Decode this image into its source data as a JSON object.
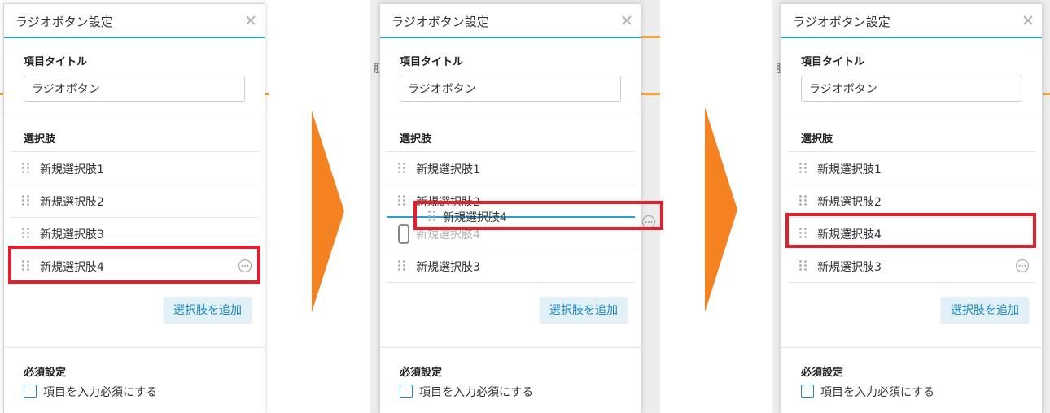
{
  "colors": {
    "accent": "#2a9fd6",
    "highlight": "#e0202c",
    "arrow": "#f58220",
    "button_bg": "#e2f1f7",
    "button_text": "#1b86b8"
  },
  "icons": {
    "close": "close-icon",
    "drag": "drag-handle-icon",
    "more": "more-options-icon",
    "arrow": "arrow-right-icon"
  },
  "background": {
    "peek_text": "朊"
  },
  "panels": [
    {
      "title": "ラジオボタン設定",
      "item_title_label": "項目タイトル",
      "item_title_value": "ラジオボタン",
      "choices_label": "選択肢",
      "options": [
        "新規選択肢1",
        "新規選択肢2",
        "新規選択肢3",
        "新規選択肢4"
      ],
      "add_button": "選択肢を追加",
      "required_label": "必須設定",
      "required_checkbox": "項目を入力必須にする"
    },
    {
      "title": "ラジオボタン設定",
      "item_title_label": "項目タイトル",
      "item_title_value": "ラジオボタン",
      "choices_label": "選択肢",
      "options": [
        "新規選択肢1",
        "新規選択肢2",
        "新規選択肢4",
        "新規選択肢3"
      ],
      "dragging_option": "新規選択肢4",
      "add_button": "選択肢を追加",
      "required_label": "必須設定",
      "required_checkbox": "項目を入力必須にする"
    },
    {
      "title": "ラジオボタン設定",
      "item_title_label": "項目タイトル",
      "item_title_value": "ラジオボタン",
      "choices_label": "選択肢",
      "options": [
        "新規選択肢1",
        "新規選択肢2",
        "新規選択肢4",
        "新規選択肢3"
      ],
      "add_button": "選択肢を追加",
      "required_label": "必須設定",
      "required_checkbox": "項目を入力必須にする"
    }
  ]
}
